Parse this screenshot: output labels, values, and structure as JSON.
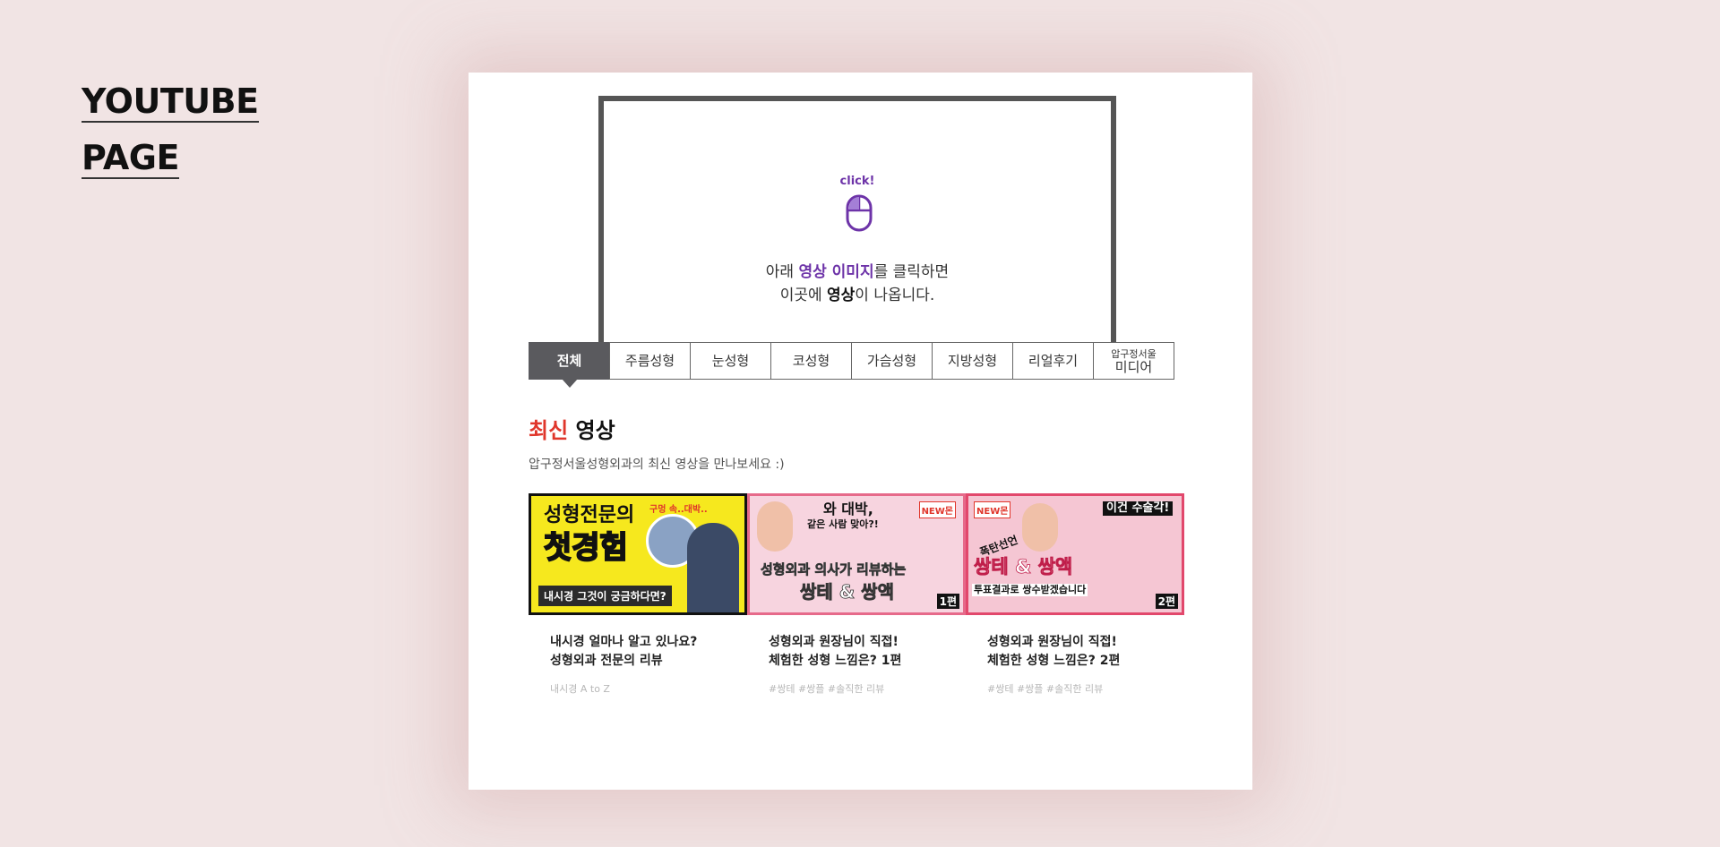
{
  "side_title": {
    "line1": "YOUTUBE",
    "line2": "PAGE"
  },
  "player": {
    "click_label": "click!",
    "icon": "mouse-icon",
    "msg1_pre": "아래 ",
    "msg1_highlight": "영상 이미지",
    "msg1_post": "를 클릭하면",
    "msg2_pre": "이곳에 ",
    "msg2_strong": "영상",
    "msg2_post": "이 나옵니다."
  },
  "tabs": [
    {
      "label": "전체",
      "active": true
    },
    {
      "label": "주름성형"
    },
    {
      "label": "눈성형"
    },
    {
      "label": "코성형"
    },
    {
      "label": "가슴성형"
    },
    {
      "label": "지방성형"
    },
    {
      "label": "리얼후기"
    },
    {
      "label_small": "압구정서울",
      "label": "미디어"
    }
  ],
  "section": {
    "title_red": "최신",
    "title_rest": " 영상",
    "subtitle": "압구정서울성형외과의 최신 영상을 만나보세요 :)"
  },
  "videos": [
    {
      "thumb_line1": "성형전문의",
      "thumb_line2": "첫경험",
      "thumb_line3": "내시경 그것이 궁금하다면?",
      "thumb_badge": "구멍 속..대박..",
      "title": "내시경 얼마나 알고 있나요?\n성형외과 전문의 리뷰",
      "tags": "내시경 A to Z"
    },
    {
      "thumb_line1": "와 대박,",
      "thumb_line2": "같은 사람 맞아?!",
      "thumb_line3": "성형외과 의사가 리뷰하는",
      "thumb_line4": "쌍테 & 쌍액",
      "thumb_badge": "NEW몬",
      "thumb_ep": "1편",
      "title": "성형외과 원장님이 직접!\n체험한 성형 느낌은? 1편",
      "tags": "#쌍테 #쌍플 #솔직한 리뷰"
    },
    {
      "thumb_line1": "이건 수술각!",
      "thumb_line2": "폭탄선언",
      "thumb_line3": "쌍테 & 쌍액",
      "thumb_line4": "투표결과로 쌍수받겠습니다",
      "thumb_badge": "NEW몬",
      "thumb_ep": "2편",
      "title": "성형외과 원장님이 직접!\n체험한 성형 느낌은? 2편",
      "tags": "#쌍테 #쌍플 #솔직한 리뷰"
    }
  ],
  "colors": {
    "accent_purple": "#6d33a8",
    "accent_red": "#e0362b",
    "tab_active": "#5a5a5e",
    "background": "#f1e4e4"
  }
}
